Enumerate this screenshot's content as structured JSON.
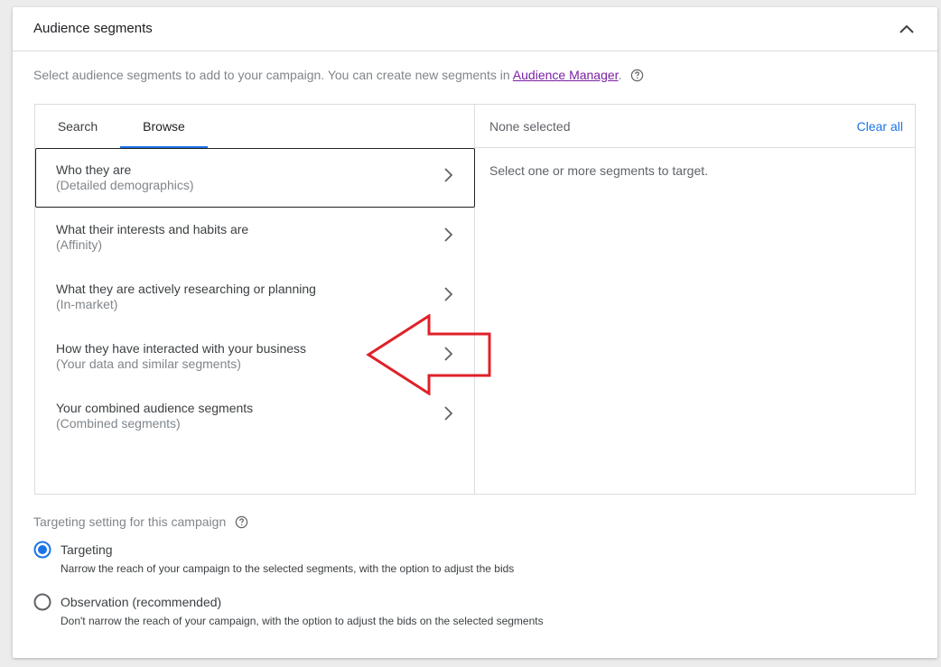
{
  "header": {
    "title": "Audience segments",
    "collapse_icon": "chevron-up-icon"
  },
  "intro": {
    "text": "Select audience segments to add to your campaign. You can create new segments in ",
    "link_text": "Audience Manager",
    "suffix": ".",
    "help_icon": "help-circle-icon"
  },
  "tabs": [
    {
      "label": "Search",
      "active": false
    },
    {
      "label": "Browse",
      "active": true
    }
  ],
  "browse_items": [
    {
      "title": "Who they are",
      "subtitle": "(Detailed demographics)",
      "focused": true
    },
    {
      "title": "What their interests and habits are",
      "subtitle": "(Affinity)"
    },
    {
      "title": "What they are actively researching or planning",
      "subtitle": "(In-market)"
    },
    {
      "title": "How they have interacted with your business",
      "subtitle": "(Your data and similar segments)"
    },
    {
      "title": "Your combined audience segments",
      "subtitle": "(Combined segments)"
    }
  ],
  "selection": {
    "status": "None selected",
    "clear_all": "Clear all",
    "empty_message": "Select one or more segments to target."
  },
  "targeting": {
    "label": "Targeting setting for this campaign",
    "help_icon": "help-circle-icon",
    "options": [
      {
        "title": "Targeting",
        "description": "Narrow the reach of your campaign to the selected segments, with the option to adjust the bids",
        "selected": true
      },
      {
        "title": "Observation (recommended)",
        "description": "Don't narrow the reach of your campaign, with the option to adjust the bids on the selected segments",
        "selected": false
      }
    ]
  },
  "colors": {
    "accent": "#1a73e8",
    "link": "#7b1fa2",
    "annotation": "#e0202a"
  }
}
